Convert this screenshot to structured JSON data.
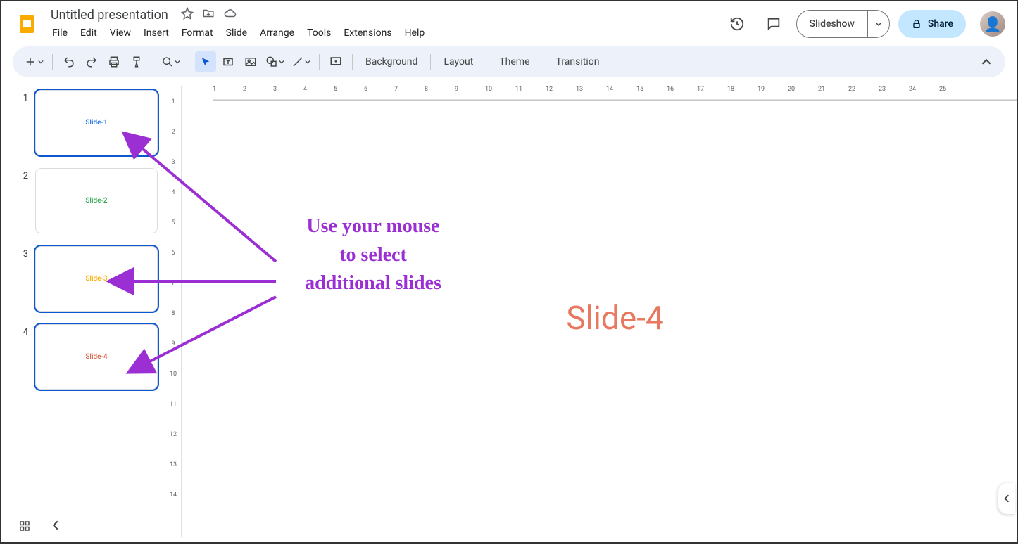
{
  "doc": {
    "title": "Untitled presentation"
  },
  "menu": {
    "file": "File",
    "edit": "Edit",
    "view": "View",
    "insert": "Insert",
    "format": "Format",
    "slide": "Slide",
    "arrange": "Arrange",
    "tools": "Tools",
    "extensions": "Extensions",
    "help": "Help"
  },
  "header_actions": {
    "slideshow": "Slideshow",
    "share": "Share"
  },
  "toolbar_text": {
    "background": "Background",
    "layout": "Layout",
    "theme": "Theme",
    "transition": "Transition"
  },
  "thumbnails": [
    {
      "num": "1",
      "label": "Slide-1",
      "color": "#1a73e8",
      "selected": true
    },
    {
      "num": "2",
      "label": "Slide-2",
      "color": "#34a853",
      "selected": false
    },
    {
      "num": "3",
      "label": "Slide-3",
      "color": "#f9ab00",
      "selected": true
    },
    {
      "num": "4",
      "label": "Slide-4",
      "color": "#d9674b",
      "selected": true
    }
  ],
  "canvas": {
    "current_label": "Slide-4"
  },
  "ruler": {
    "h": [
      "1",
      "2",
      "3",
      "4",
      "5",
      "6",
      "7",
      "8",
      "9",
      "10",
      "11",
      "12",
      "13",
      "14",
      "15",
      "16",
      "17",
      "18",
      "19",
      "20",
      "21",
      "22",
      "23",
      "24",
      "25"
    ],
    "v": [
      "1",
      "2",
      "3",
      "4",
      "5",
      "6",
      "7",
      "8",
      "9",
      "10",
      "11",
      "12",
      "13",
      "14"
    ]
  },
  "annotation": {
    "line1": "Use your mouse",
    "line2": "to select",
    "line3": "additional slides"
  }
}
